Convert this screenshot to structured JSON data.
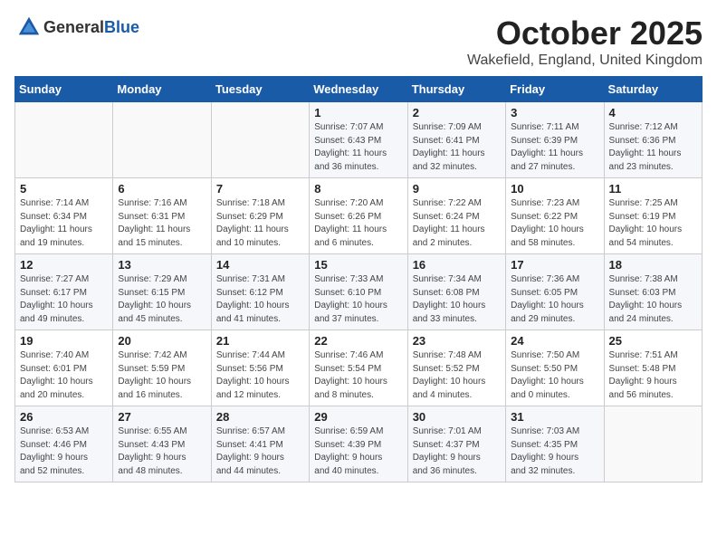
{
  "header": {
    "logo_general": "General",
    "logo_blue": "Blue",
    "month": "October 2025",
    "location": "Wakefield, England, United Kingdom"
  },
  "days_of_week": [
    "Sunday",
    "Monday",
    "Tuesday",
    "Wednesday",
    "Thursday",
    "Friday",
    "Saturday"
  ],
  "weeks": [
    [
      {
        "day": "",
        "info": ""
      },
      {
        "day": "",
        "info": ""
      },
      {
        "day": "",
        "info": ""
      },
      {
        "day": "1",
        "info": "Sunrise: 7:07 AM\nSunset: 6:43 PM\nDaylight: 11 hours\nand 36 minutes."
      },
      {
        "day": "2",
        "info": "Sunrise: 7:09 AM\nSunset: 6:41 PM\nDaylight: 11 hours\nand 32 minutes."
      },
      {
        "day": "3",
        "info": "Sunrise: 7:11 AM\nSunset: 6:39 PM\nDaylight: 11 hours\nand 27 minutes."
      },
      {
        "day": "4",
        "info": "Sunrise: 7:12 AM\nSunset: 6:36 PM\nDaylight: 11 hours\nand 23 minutes."
      }
    ],
    [
      {
        "day": "5",
        "info": "Sunrise: 7:14 AM\nSunset: 6:34 PM\nDaylight: 11 hours\nand 19 minutes."
      },
      {
        "day": "6",
        "info": "Sunrise: 7:16 AM\nSunset: 6:31 PM\nDaylight: 11 hours\nand 15 minutes."
      },
      {
        "day": "7",
        "info": "Sunrise: 7:18 AM\nSunset: 6:29 PM\nDaylight: 11 hours\nand 10 minutes."
      },
      {
        "day": "8",
        "info": "Sunrise: 7:20 AM\nSunset: 6:26 PM\nDaylight: 11 hours\nand 6 minutes."
      },
      {
        "day": "9",
        "info": "Sunrise: 7:22 AM\nSunset: 6:24 PM\nDaylight: 11 hours\nand 2 minutes."
      },
      {
        "day": "10",
        "info": "Sunrise: 7:23 AM\nSunset: 6:22 PM\nDaylight: 10 hours\nand 58 minutes."
      },
      {
        "day": "11",
        "info": "Sunrise: 7:25 AM\nSunset: 6:19 PM\nDaylight: 10 hours\nand 54 minutes."
      }
    ],
    [
      {
        "day": "12",
        "info": "Sunrise: 7:27 AM\nSunset: 6:17 PM\nDaylight: 10 hours\nand 49 minutes."
      },
      {
        "day": "13",
        "info": "Sunrise: 7:29 AM\nSunset: 6:15 PM\nDaylight: 10 hours\nand 45 minutes."
      },
      {
        "day": "14",
        "info": "Sunrise: 7:31 AM\nSunset: 6:12 PM\nDaylight: 10 hours\nand 41 minutes."
      },
      {
        "day": "15",
        "info": "Sunrise: 7:33 AM\nSunset: 6:10 PM\nDaylight: 10 hours\nand 37 minutes."
      },
      {
        "day": "16",
        "info": "Sunrise: 7:34 AM\nSunset: 6:08 PM\nDaylight: 10 hours\nand 33 minutes."
      },
      {
        "day": "17",
        "info": "Sunrise: 7:36 AM\nSunset: 6:05 PM\nDaylight: 10 hours\nand 29 minutes."
      },
      {
        "day": "18",
        "info": "Sunrise: 7:38 AM\nSunset: 6:03 PM\nDaylight: 10 hours\nand 24 minutes."
      }
    ],
    [
      {
        "day": "19",
        "info": "Sunrise: 7:40 AM\nSunset: 6:01 PM\nDaylight: 10 hours\nand 20 minutes."
      },
      {
        "day": "20",
        "info": "Sunrise: 7:42 AM\nSunset: 5:59 PM\nDaylight: 10 hours\nand 16 minutes."
      },
      {
        "day": "21",
        "info": "Sunrise: 7:44 AM\nSunset: 5:56 PM\nDaylight: 10 hours\nand 12 minutes."
      },
      {
        "day": "22",
        "info": "Sunrise: 7:46 AM\nSunset: 5:54 PM\nDaylight: 10 hours\nand 8 minutes."
      },
      {
        "day": "23",
        "info": "Sunrise: 7:48 AM\nSunset: 5:52 PM\nDaylight: 10 hours\nand 4 minutes."
      },
      {
        "day": "24",
        "info": "Sunrise: 7:50 AM\nSunset: 5:50 PM\nDaylight: 10 hours\nand 0 minutes."
      },
      {
        "day": "25",
        "info": "Sunrise: 7:51 AM\nSunset: 5:48 PM\nDaylight: 9 hours\nand 56 minutes."
      }
    ],
    [
      {
        "day": "26",
        "info": "Sunrise: 6:53 AM\nSunset: 4:46 PM\nDaylight: 9 hours\nand 52 minutes."
      },
      {
        "day": "27",
        "info": "Sunrise: 6:55 AM\nSunset: 4:43 PM\nDaylight: 9 hours\nand 48 minutes."
      },
      {
        "day": "28",
        "info": "Sunrise: 6:57 AM\nSunset: 4:41 PM\nDaylight: 9 hours\nand 44 minutes."
      },
      {
        "day": "29",
        "info": "Sunrise: 6:59 AM\nSunset: 4:39 PM\nDaylight: 9 hours\nand 40 minutes."
      },
      {
        "day": "30",
        "info": "Sunrise: 7:01 AM\nSunset: 4:37 PM\nDaylight: 9 hours\nand 36 minutes."
      },
      {
        "day": "31",
        "info": "Sunrise: 7:03 AM\nSunset: 4:35 PM\nDaylight: 9 hours\nand 32 minutes."
      },
      {
        "day": "",
        "info": ""
      }
    ]
  ]
}
